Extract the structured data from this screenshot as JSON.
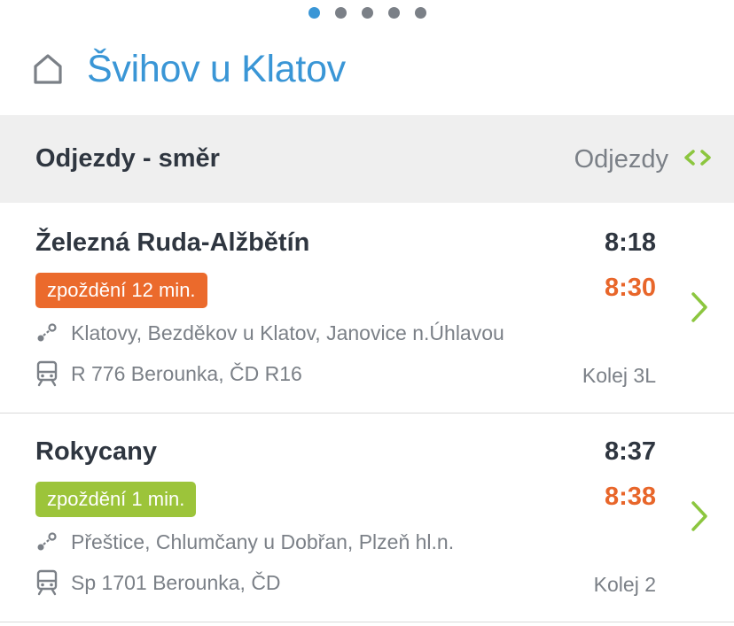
{
  "pager": {
    "count": 5,
    "active": 0
  },
  "header": {
    "title": "Švihov u Klatov",
    "icon": "home-icon"
  },
  "section": {
    "title": "Odjezdy - směr",
    "switch_label": "Odjezdy",
    "accent": "#8cc63f"
  },
  "departures": [
    {
      "destination": "Železná Ruda-Alžbětín",
      "scheduled": "8:18",
      "delay": "zpoždění 12 min.",
      "delay_color": "#eb6a2c",
      "actual": "8:30",
      "via": "Klatovy, Bezděkov u Klatov, Janovice n.Úhlavou",
      "train": "R 776 Berounka, ČD R16",
      "platform": "Kolej 3L"
    },
    {
      "destination": "Rokycany",
      "scheduled": "8:37",
      "delay": "zpoždění 1 min.",
      "delay_color": "#9cc43a",
      "actual": "8:38",
      "via": "Přeštice, Chlumčany u Dobřan, Plzeň hl.n.",
      "train": "Sp 1701 Berounka, ČD",
      "platform": "Kolej 2"
    }
  ],
  "colors": {
    "title_blue": "#3a96d6",
    "delay_time": "#e8662a",
    "chevron_green": "#8cc63f"
  }
}
